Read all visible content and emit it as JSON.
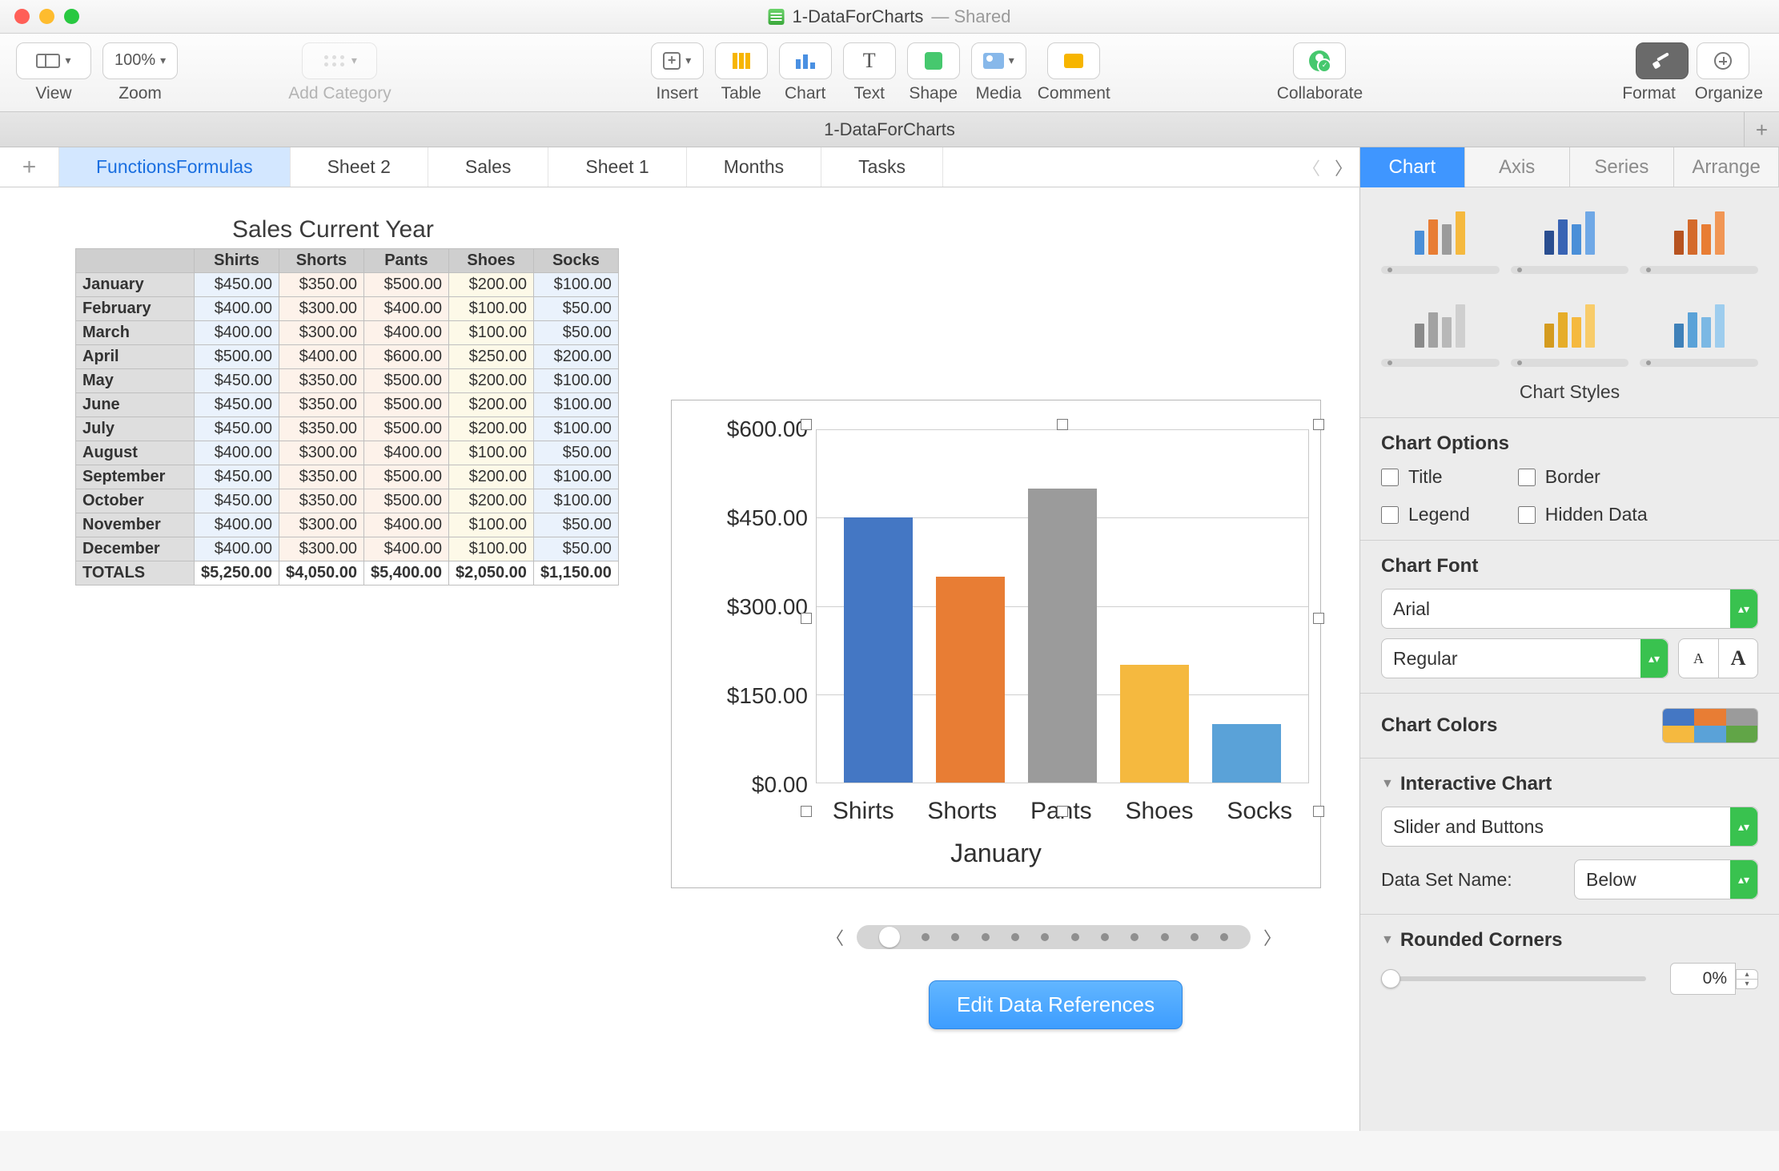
{
  "window": {
    "title": "1-DataForCharts",
    "shared_label": "— Shared"
  },
  "toolbar": {
    "view": "View",
    "zoom_label": "Zoom",
    "zoom_value": "100%",
    "add_category": "Add Category",
    "insert": "Insert",
    "table": "Table",
    "chart": "Chart",
    "text": "Text",
    "shape": "Shape",
    "media": "Media",
    "comment": "Comment",
    "collaborate": "Collaborate",
    "format": "Format",
    "organize": "Organize"
  },
  "docstrip": {
    "title": "1-DataForCharts"
  },
  "sheets": {
    "tabs": [
      "FunctionsFormulas",
      "Sheet 2",
      "Sales",
      "Sheet 1",
      "Months",
      "Tasks"
    ],
    "active_index": 0
  },
  "table": {
    "title": "Sales Current Year",
    "columns": [
      "Shirts",
      "Shorts",
      "Pants",
      "Shoes",
      "Socks"
    ],
    "rows": [
      {
        "label": "January",
        "cells": [
          "$450.00",
          "$350.00",
          "$500.00",
          "$200.00",
          "$100.00"
        ]
      },
      {
        "label": "February",
        "cells": [
          "$400.00",
          "$300.00",
          "$400.00",
          "$100.00",
          "$50.00"
        ]
      },
      {
        "label": "March",
        "cells": [
          "$400.00",
          "$300.00",
          "$400.00",
          "$100.00",
          "$50.00"
        ]
      },
      {
        "label": "April",
        "cells": [
          "$500.00",
          "$400.00",
          "$600.00",
          "$250.00",
          "$200.00"
        ]
      },
      {
        "label": "May",
        "cells": [
          "$450.00",
          "$350.00",
          "$500.00",
          "$200.00",
          "$100.00"
        ]
      },
      {
        "label": "June",
        "cells": [
          "$450.00",
          "$350.00",
          "$500.00",
          "$200.00",
          "$100.00"
        ]
      },
      {
        "label": "July",
        "cells": [
          "$450.00",
          "$350.00",
          "$500.00",
          "$200.00",
          "$100.00"
        ]
      },
      {
        "label": "August",
        "cells": [
          "$400.00",
          "$300.00",
          "$400.00",
          "$100.00",
          "$50.00"
        ]
      },
      {
        "label": "September",
        "cells": [
          "$450.00",
          "$350.00",
          "$500.00",
          "$200.00",
          "$100.00"
        ]
      },
      {
        "label": "October",
        "cells": [
          "$450.00",
          "$350.00",
          "$500.00",
          "$200.00",
          "$100.00"
        ]
      },
      {
        "label": "November",
        "cells": [
          "$400.00",
          "$300.00",
          "$400.00",
          "$100.00",
          "$50.00"
        ]
      },
      {
        "label": "December",
        "cells": [
          "$400.00",
          "$300.00",
          "$400.00",
          "$100.00",
          "$50.00"
        ]
      }
    ],
    "totals": {
      "label": "TOTALS",
      "cells": [
        "$5,250.00",
        "$4,050.00",
        "$5,400.00",
        "$2,050.00",
        "$1,150.00"
      ]
    }
  },
  "chart_data": {
    "type": "bar",
    "title": "January",
    "categories": [
      "Shirts",
      "Shorts",
      "Pants",
      "Shoes",
      "Socks"
    ],
    "values": [
      450,
      350,
      500,
      200,
      100
    ],
    "ylabel": "",
    "xlabel": "",
    "ylim": [
      0,
      600
    ],
    "y_ticks": [
      "$600.00",
      "$450.00",
      "$300.00",
      "$150.00",
      "$0.00"
    ],
    "colors": [
      "#4477c4",
      "#e87d34",
      "#9b9b9b",
      "#f5b93f",
      "#5aa2d8"
    ],
    "edit_button": "Edit Data References"
  },
  "inspector": {
    "tabs": [
      "Chart",
      "Axis",
      "Series",
      "Arrange"
    ],
    "active_index": 0,
    "styles_title": "Chart Styles",
    "options": {
      "heading": "Chart Options",
      "title": "Title",
      "border": "Border",
      "legend": "Legend",
      "hidden": "Hidden Data"
    },
    "font": {
      "heading": "Chart Font",
      "family": "Arial",
      "style": "Regular"
    },
    "colors": {
      "heading": "Chart Colors"
    },
    "interactive": {
      "heading": "Interactive Chart",
      "mode": "Slider and Buttons",
      "dataset_label": "Data Set Name:",
      "dataset_value": "Below"
    },
    "rounded": {
      "heading": "Rounded Corners",
      "value": "0%"
    }
  }
}
